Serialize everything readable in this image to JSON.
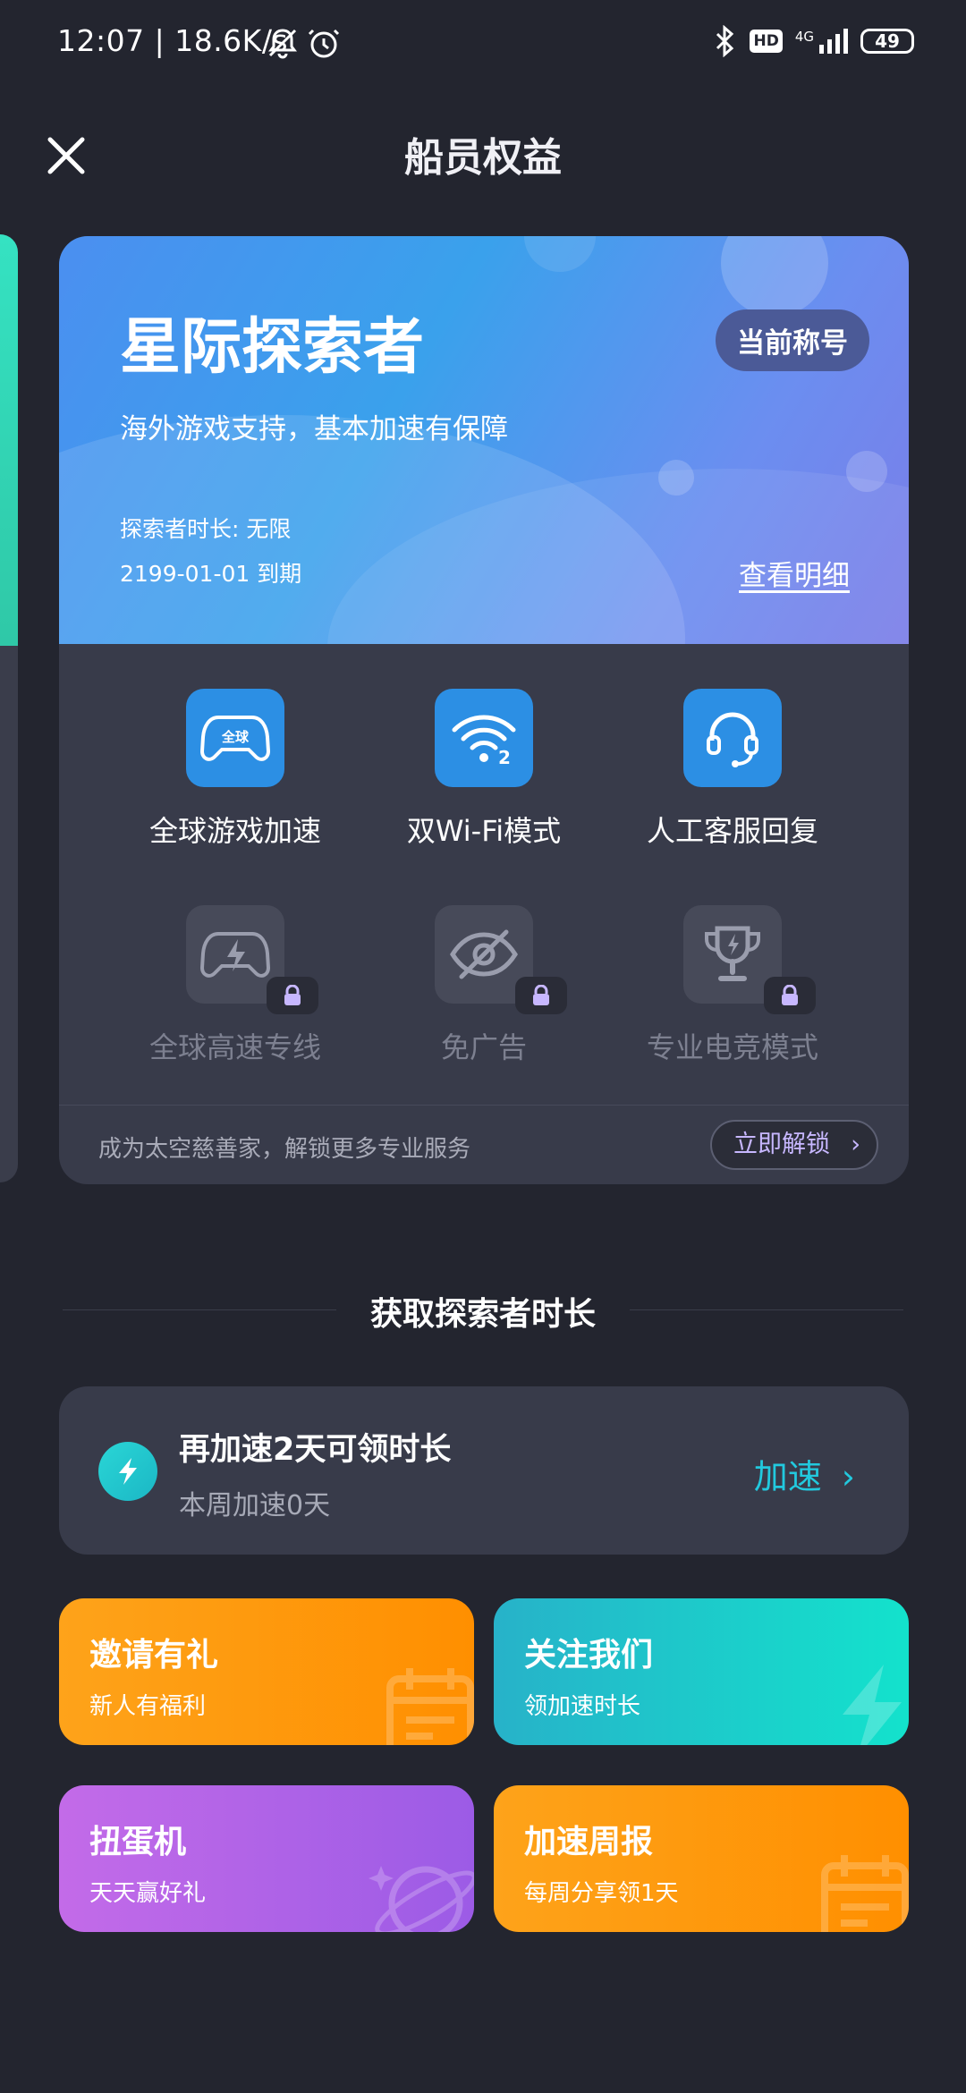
{
  "status_bar": {
    "time_speed": "12:07 | 18.6K/s",
    "network": "4G",
    "hd": "HD",
    "battery": "49"
  },
  "header": {
    "title": "船员权益"
  },
  "membership_card": {
    "title": "星际探索者",
    "badge": "当前称号",
    "subtitle": "海外游戏支持，基本加速有保障",
    "duration": "探索者时长: 无限",
    "expiry": "2199-01-01 到期",
    "detail_link": "查看明细",
    "features": [
      {
        "label": "全球游戏加速",
        "icon": "gamepad-global-icon",
        "unlocked": true
      },
      {
        "label": "双Wi-Fi模式",
        "icon": "dual-wifi-icon",
        "unlocked": true
      },
      {
        "label": "人工客服回复",
        "icon": "headset-icon",
        "unlocked": true
      },
      {
        "label": "全球高速专线",
        "icon": "gamepad-bolt-icon",
        "unlocked": false
      },
      {
        "label": "免广告",
        "icon": "no-ads-eye-icon",
        "unlocked": false
      },
      {
        "label": "专业电竞模式",
        "icon": "trophy-icon",
        "unlocked": false
      }
    ],
    "footer_text": "成为太空慈善家，解锁更多专业服务",
    "unlock_button": "立即解锁"
  },
  "section": {
    "title": "获取探索者时长"
  },
  "task": {
    "title": "再加速2天可领时长",
    "subtitle": "本周加速0天",
    "button": "加速"
  },
  "tiles": [
    {
      "title": "邀请有礼",
      "subtitle": "新人有福利"
    },
    {
      "title": "关注我们",
      "subtitle": "领加速时长"
    },
    {
      "title": "扭蛋机",
      "subtitle": "天天赢好礼"
    },
    {
      "title": "加速周报",
      "subtitle": "每周分享领1天"
    }
  ],
  "colors": {
    "background": "#23252f",
    "card": "#383b4a",
    "feature_icon_active": "#2c8fe4",
    "accent_cyan": "#22c9de",
    "unlock_purple": "#c7b7ff"
  }
}
